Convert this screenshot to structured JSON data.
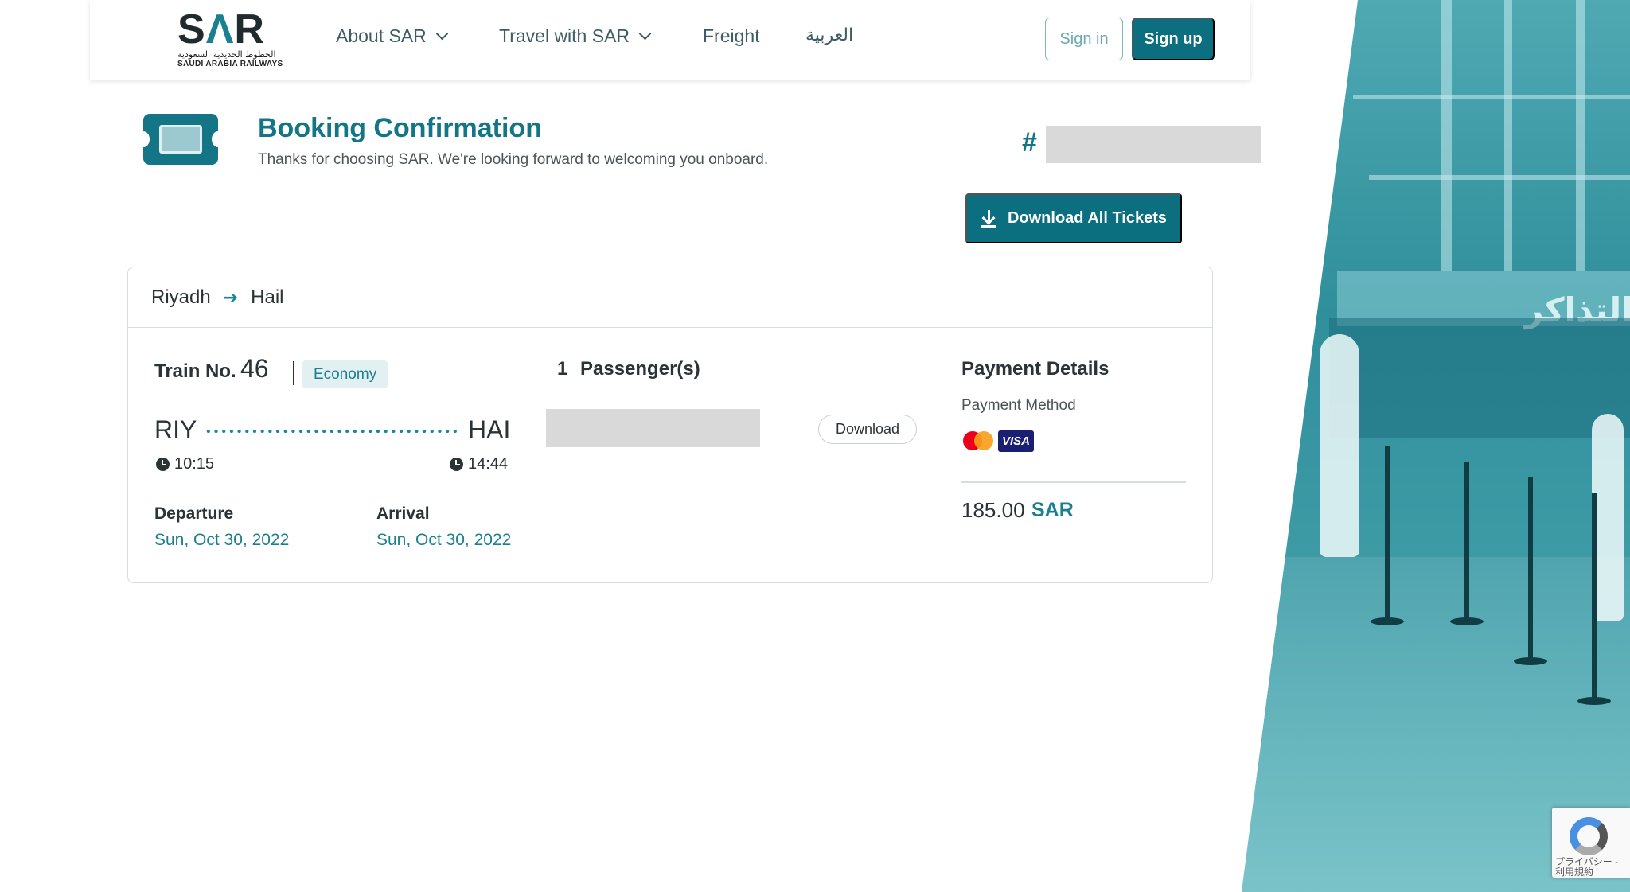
{
  "header": {
    "logo": {
      "mark": "SAR",
      "arabic_name": "الخطوط الحديدية السعودية",
      "english_name": "SAUDI ARABIA RAILWAYS"
    },
    "nav": [
      {
        "label": "About SAR",
        "has_dropdown": true
      },
      {
        "label": "Travel with SAR",
        "has_dropdown": true
      },
      {
        "label": "Freight",
        "has_dropdown": false
      },
      {
        "label": "العربية",
        "has_dropdown": false
      }
    ],
    "sign_in_label": "Sign in",
    "sign_up_label": "Sign up"
  },
  "confirmation": {
    "title": "Booking Confirmation",
    "subtitle": "Thanks for choosing SAR. We're looking forward to welcoming you onboard.",
    "ref_prefix": "#",
    "download_all_label": "Download All Tickets"
  },
  "trip": {
    "origin": "Riyadh",
    "destination": "Hail",
    "train_label": "Train No.",
    "train_number": "46",
    "class": "Economy",
    "origin_code": "RIY",
    "destination_code": "HAI",
    "departure_time": "10:15",
    "arrival_time": "14:44",
    "departure_label": "Departure",
    "arrival_label": "Arrival",
    "departure_date": "Sun, Oct 30, 2022",
    "arrival_date": "Sun, Oct 30, 2022"
  },
  "passengers": {
    "count": "1",
    "label": "Passenger(s)",
    "download_label": "Download"
  },
  "payment": {
    "title": "Payment Details",
    "method_label": "Payment Method",
    "cards": [
      "mastercard",
      "visa"
    ],
    "visa_text": "VISA",
    "amount": "185.00",
    "currency": "SAR"
  },
  "background": {
    "sign_text": "التذاكر"
  },
  "recaptcha": {
    "text_line1": "プライバシー -",
    "text_line2": "利用規約"
  },
  "colors": {
    "brand_teal": "#0b6f7f",
    "accent_teal": "#1a7f8e",
    "placeholder_gray": "#d9d9d9"
  }
}
